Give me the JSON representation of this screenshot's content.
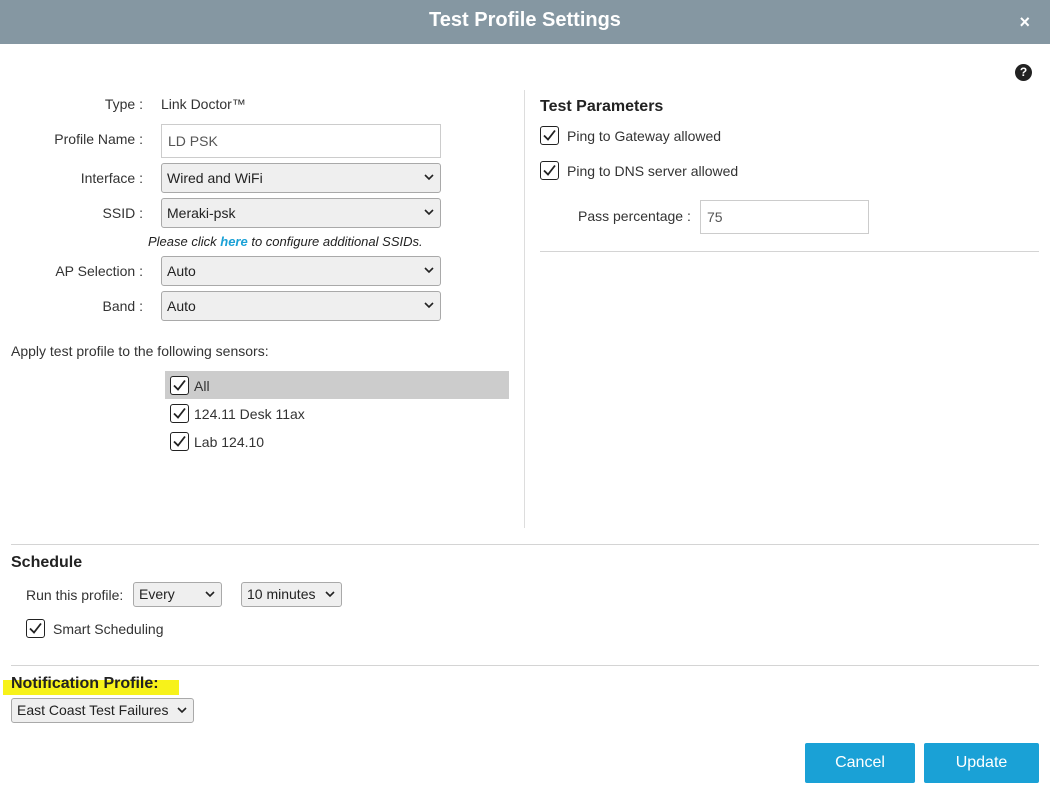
{
  "dialog": {
    "title": "Test Profile Settings",
    "close_glyph": "×",
    "help_glyph": "?"
  },
  "form": {
    "type_label": "Type :",
    "type_value": "Link Doctor™",
    "profile_name_label": "Profile Name :",
    "profile_name_value": "LD PSK",
    "interface_label": "Interface :",
    "interface_value": "Wired and WiFi",
    "ssid_label": "SSID :",
    "ssid_value": "Meraki-psk",
    "note_prefix": "Please click ",
    "note_link": "here",
    "note_suffix": " to configure additional SSIDs.",
    "ap_selection_label": "AP Selection :",
    "ap_selection_value": "Auto",
    "band_label": "Band :",
    "band_value": "Auto"
  },
  "sensors": {
    "heading": "Apply test profile to the following sensors:",
    "items": [
      {
        "label": "All",
        "checked": true
      },
      {
        "label": "124.11 Desk 11ax",
        "checked": true
      },
      {
        "label": "Lab 124.10",
        "checked": true
      }
    ]
  },
  "test_parameters": {
    "heading": "Test Parameters",
    "ping_gateway_label": "Ping to Gateway allowed",
    "ping_gateway_checked": true,
    "ping_dns_label": "Ping to DNS server allowed",
    "ping_dns_checked": true,
    "pass_percentage_label": "Pass percentage :",
    "pass_percentage_value": "75"
  },
  "schedule": {
    "heading": "Schedule",
    "run_label": "Run this profile:",
    "frequency_value": "Every",
    "interval_value": "10 minutes",
    "smart_scheduling_label": "Smart Scheduling",
    "smart_scheduling_checked": true
  },
  "notification": {
    "heading": "Notification Profile:",
    "profile_value": "East Coast Test Failures",
    "highlight_color": "#f7f21a"
  },
  "buttons": {
    "cancel": "Cancel",
    "update": "Update",
    "accent_color": "#1aa1d6"
  },
  "icons": {
    "close": "close-icon",
    "help": "help-icon",
    "dropdown": "chevron-down-icon",
    "checkbox": "checkmark-icon"
  }
}
